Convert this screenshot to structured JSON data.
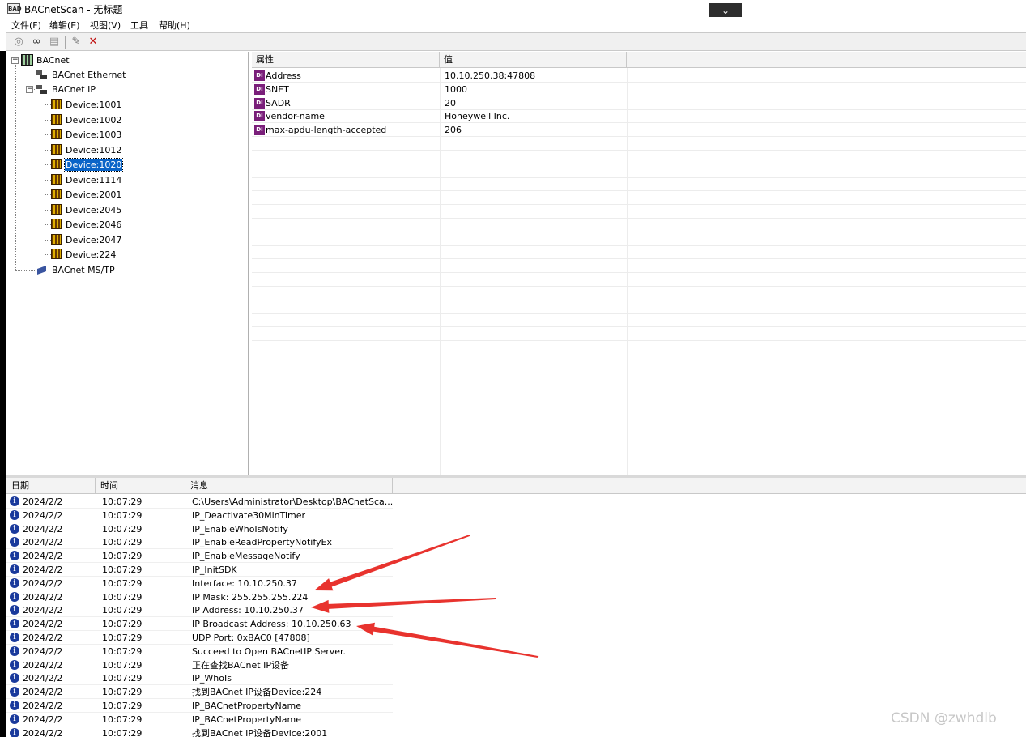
{
  "window": {
    "app_icon": "BAD",
    "title": "BACnetScan - 无标题",
    "collapse_glyph": "⌄"
  },
  "menu": [
    "文件(F)",
    "编辑(E)",
    "视图(V)",
    "工具",
    "帮助(H)"
  ],
  "toolbar": {
    "icons": [
      "view-icon",
      "binoculars-icon",
      "properties-icon",
      "pencil-icon",
      "delete-icon"
    ]
  },
  "tree": {
    "root": {
      "label": "BACnet",
      "expander": "−"
    },
    "networks": [
      {
        "label": "BACnet Ethernet"
      },
      {
        "label": "BACnet IP",
        "expander": "−"
      },
      {
        "label": "BACnet MS/TP"
      }
    ],
    "devices": [
      "Device:1001",
      "Device:1002",
      "Device:1003",
      "Device:1012",
      "Device:1020",
      "Device:1114",
      "Device:2001",
      "Device:2045",
      "Device:2046",
      "Device:2047",
      "Device:224"
    ],
    "selected": "Device:1020"
  },
  "properties": {
    "headers": [
      "属性",
      "值"
    ],
    "icon_text": "DI",
    "rows": [
      {
        "name": "Address",
        "value": "10.10.250.38:47808"
      },
      {
        "name": "SNET",
        "value": "1000"
      },
      {
        "name": "SADR",
        "value": "20"
      },
      {
        "name": "vendor-name",
        "value": "Honeywell Inc."
      },
      {
        "name": "max-apdu-length-accepted",
        "value": "206"
      }
    ]
  },
  "log": {
    "headers": [
      "日期",
      "时间",
      "消息"
    ],
    "info_glyph": "i",
    "rows": [
      {
        "date": "2024/2/2",
        "time": "10:07:29",
        "msg": "C:\\Users\\Administrator\\Desktop\\BACnetSca..."
      },
      {
        "date": "2024/2/2",
        "time": "10:07:29",
        "msg": "IP_Deactivate30MinTimer"
      },
      {
        "date": "2024/2/2",
        "time": "10:07:29",
        "msg": "IP_EnableWhoIsNotify"
      },
      {
        "date": "2024/2/2",
        "time": "10:07:29",
        "msg": "IP_EnableReadPropertyNotifyEx"
      },
      {
        "date": "2024/2/2",
        "time": "10:07:29",
        "msg": "IP_EnableMessageNotify"
      },
      {
        "date": "2024/2/2",
        "time": "10:07:29",
        "msg": "IP_InitSDK"
      },
      {
        "date": "2024/2/2",
        "time": "10:07:29",
        "msg": "Interface: 10.10.250.37"
      },
      {
        "date": "2024/2/2",
        "time": "10:07:29",
        "msg": "IP Mask: 255.255.255.224"
      },
      {
        "date": "2024/2/2",
        "time": "10:07:29",
        "msg": "IP Address: 10.10.250.37"
      },
      {
        "date": "2024/2/2",
        "time": "10:07:29",
        "msg": "IP Broadcast Address: 10.10.250.63"
      },
      {
        "date": "2024/2/2",
        "time": "10:07:29",
        "msg": "UDP Port: 0xBAC0 [47808]"
      },
      {
        "date": "2024/2/2",
        "time": "10:07:29",
        "msg": "Succeed to Open BACnetIP Server."
      },
      {
        "date": "2024/2/2",
        "time": "10:07:29",
        "msg": "正在查找BACnet IP设备"
      },
      {
        "date": "2024/2/2",
        "time": "10:07:29",
        "msg": "IP_WhoIs"
      },
      {
        "date": "2024/2/2",
        "time": "10:07:29",
        "msg": "找到BACnet IP设备Device:224"
      },
      {
        "date": "2024/2/2",
        "time": "10:07:29",
        "msg": "IP_BACnetPropertyName"
      },
      {
        "date": "2024/2/2",
        "time": "10:07:29",
        "msg": "IP_BACnetPropertyName"
      },
      {
        "date": "2024/2/2",
        "time": "10:07:29",
        "msg": "找到BACnet IP设备Device:2001"
      }
    ]
  },
  "annotations": {
    "arrow_color": "#e8332e"
  },
  "watermark": "CSDN @zwhdlb"
}
